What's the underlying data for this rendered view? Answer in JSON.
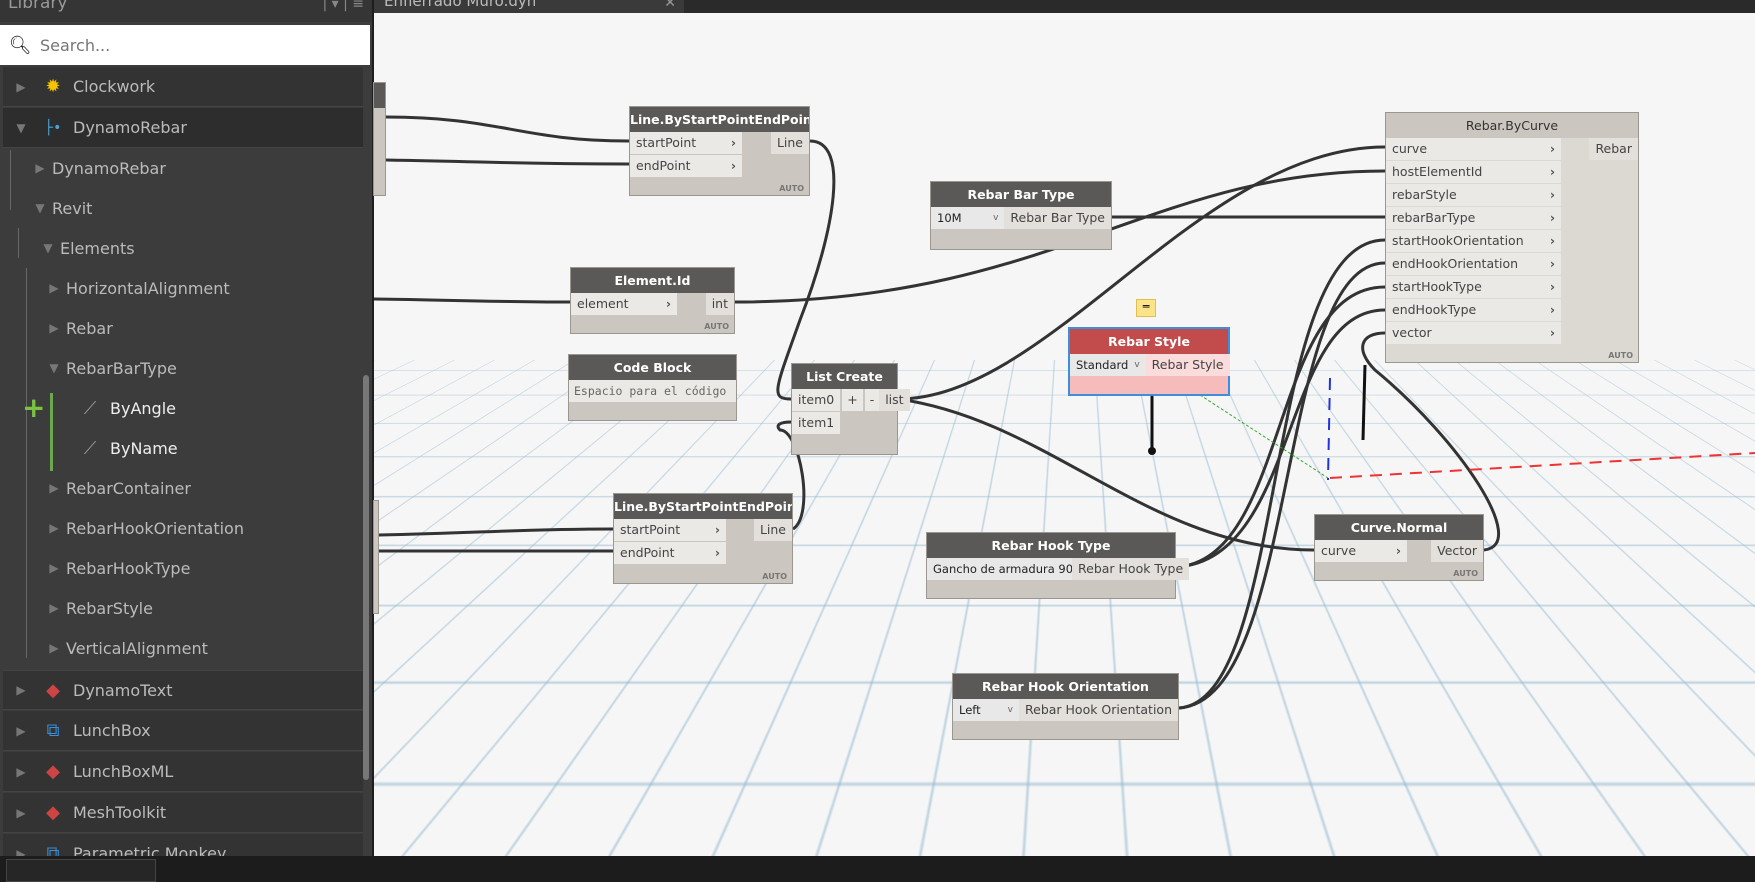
{
  "library": {
    "title": "Library",
    "search_placeholder": "Search...",
    "items": [
      {
        "label": "Clockwork",
        "icon": "gear-icon"
      },
      {
        "label": "DynamoRebar",
        "icon": "rebar-package-icon"
      },
      {
        "label": "DynamoRebar"
      },
      {
        "label": "Revit"
      },
      {
        "label": "Elements"
      },
      {
        "label": "HorizontalAlignment"
      },
      {
        "label": "Rebar"
      },
      {
        "label": "RebarBarType"
      },
      {
        "label": "ByAngle"
      },
      {
        "label": "ByName"
      },
      {
        "label": "RebarContainer"
      },
      {
        "label": "RebarHookOrientation"
      },
      {
        "label": "RebarHookType"
      },
      {
        "label": "RebarStyle"
      },
      {
        "label": "VerticalAlignment"
      },
      {
        "label": "DynamoText"
      },
      {
        "label": "LunchBox"
      },
      {
        "label": "LunchBoxML"
      },
      {
        "label": "MeshToolkit"
      },
      {
        "label": "Parametric Monkey"
      }
    ]
  },
  "tab": {
    "title": "Enfierrado Muro.dyn"
  },
  "nodes": {
    "line1": {
      "title": "Line.ByStartPointEndPoint",
      "in": [
        "startPoint",
        "endPoint"
      ],
      "out": "Line",
      "lacing": "AUTO"
    },
    "line2": {
      "title": "Line.ByStartPointEndPoint",
      "in": [
        "startPoint",
        "endPoint"
      ],
      "out": "Line",
      "lacing": "AUTO"
    },
    "bartype": {
      "title": "Rebar Bar Type",
      "value": "10M",
      "out": "Rebar Bar Type"
    },
    "elementid": {
      "title": "Element.Id",
      "in": "element",
      "out": "int",
      "lacing": "AUTO"
    },
    "codeblock": {
      "title": "Code Block",
      "placeholder": "Espacio para el código"
    },
    "listcreate": {
      "title": "List Create",
      "in": [
        "item0",
        "item1"
      ],
      "add": "+",
      "remove": "-",
      "out": "list"
    },
    "rebarstyle": {
      "title": "Rebar Style",
      "value": "Standard",
      "out": "Rebar Style"
    },
    "bycurve": {
      "title": "Rebar.ByCurve",
      "in": [
        "curve",
        "hostElementId",
        "rebarStyle",
        "rebarBarType",
        "startHookOrientation",
        "endHookOrientation",
        "startHookType",
        "endHookType",
        "vector"
      ],
      "out": "Rebar",
      "lacing": "AUTO"
    },
    "hooktype": {
      "title": "Rebar Hook Type",
      "value": "Gancho de armadura 90",
      "out": "Rebar Hook Type"
    },
    "curvenormal": {
      "title": "Curve.Normal",
      "in": "curve",
      "out": "Vector",
      "lacing": "AUTO"
    },
    "hookorient": {
      "title": "Rebar Hook Orientation",
      "value": "Left",
      "out": "Rebar Hook Orientation"
    }
  },
  "colors": {
    "node_header": "#5b5957",
    "error_header": "#c24c4c",
    "selection": "#3c8fdc",
    "add_green": "#7cc242"
  }
}
